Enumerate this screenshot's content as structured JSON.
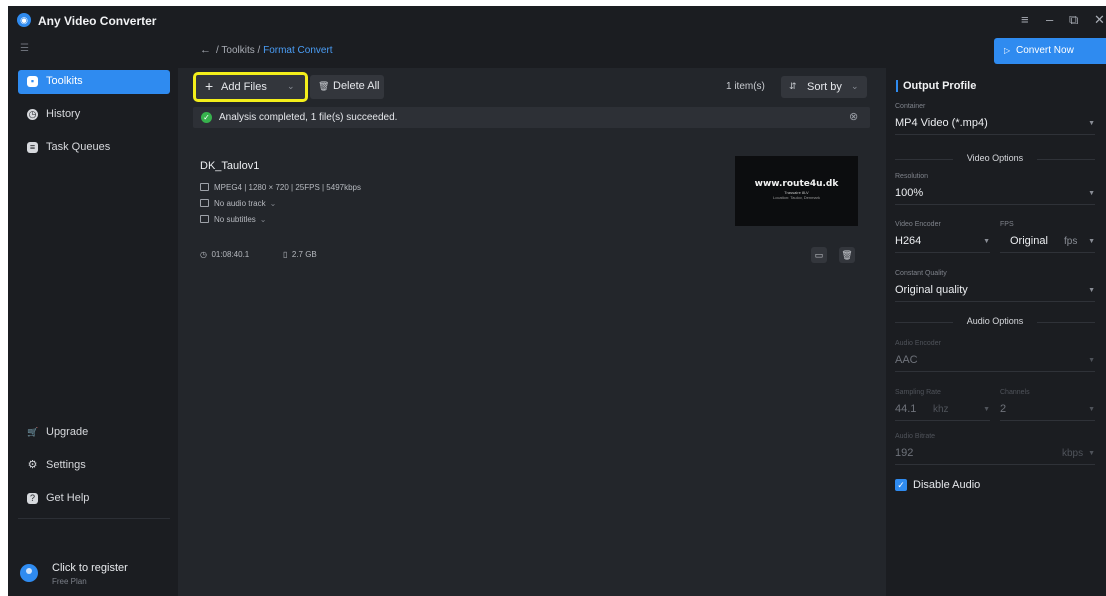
{
  "app": {
    "title": "Any Video Converter",
    "logo_icon": "app-logo-icon",
    "accent": "#2f8bf0"
  },
  "window_controls": {
    "menu": "≡",
    "minimize": "–",
    "restore": "⧉",
    "close": "✕"
  },
  "sidebar": {
    "items": [
      {
        "label": "Toolkits",
        "icon": "toolbox-icon",
        "active": true
      },
      {
        "label": "History",
        "icon": "clock-icon",
        "active": false
      },
      {
        "label": "Task Queues",
        "icon": "queue-icon",
        "active": false
      }
    ],
    "bottom_items": [
      {
        "label": "Upgrade",
        "icon": "cart-icon"
      },
      {
        "label": "Settings",
        "icon": "gear-icon"
      },
      {
        "label": "Get Help",
        "icon": "help-icon"
      }
    ],
    "user": {
      "title": "Click to register",
      "plan": "Free Plan"
    }
  },
  "breadcrumb": {
    "root": "Toolkits",
    "separator": "/",
    "current": "Format Convert"
  },
  "convert_button": {
    "label": "Convert Now"
  },
  "toolbar": {
    "add_files": "Add Files",
    "delete_all": "Delete All",
    "item_count": "1 item(s)",
    "sort_by": "Sort by"
  },
  "status": {
    "message": "Analysis completed, 1 file(s) succeeded.",
    "color": "#37b24d"
  },
  "file": {
    "name": "DK_Taulov1",
    "video_info": "MPEG4 | 1280 × 720 | 25FPS | 5497kbps",
    "audio_track": "No audio track",
    "subtitles": "No subtitles",
    "duration": "01:08:40.1",
    "size": "2.7 GB",
    "thumbnail": {
      "title": "www.route4u.dk",
      "line1": "Trassaire 8LV",
      "line2": "Location: Taulov, Denmark"
    }
  },
  "output_profile": {
    "title": "Output Profile",
    "container": {
      "label": "Container",
      "value": "MP4 Video (*.mp4)"
    },
    "video_options_label": "Video Options",
    "resolution": {
      "label": "Resolution",
      "value": "100%"
    },
    "video_encoder": {
      "label": "Video Encoder",
      "value": "H264"
    },
    "fps": {
      "label": "FPS",
      "value": "Original",
      "unit": "fps"
    },
    "quality": {
      "label": "Constant Quality",
      "value": "Original quality"
    },
    "audio_options_label": "Audio Options",
    "audio_encoder": {
      "label": "Audio Encoder",
      "value": "AAC"
    },
    "sampling_rate": {
      "label": "Sampling Rate",
      "value": "44.1",
      "unit": "khz"
    },
    "channels": {
      "label": "Channels",
      "value": "2"
    },
    "audio_bitrate": {
      "label": "Audio Bitrate",
      "value": "192",
      "unit": "kbps"
    },
    "disable_audio": {
      "label": "Disable Audio",
      "checked": true
    }
  }
}
